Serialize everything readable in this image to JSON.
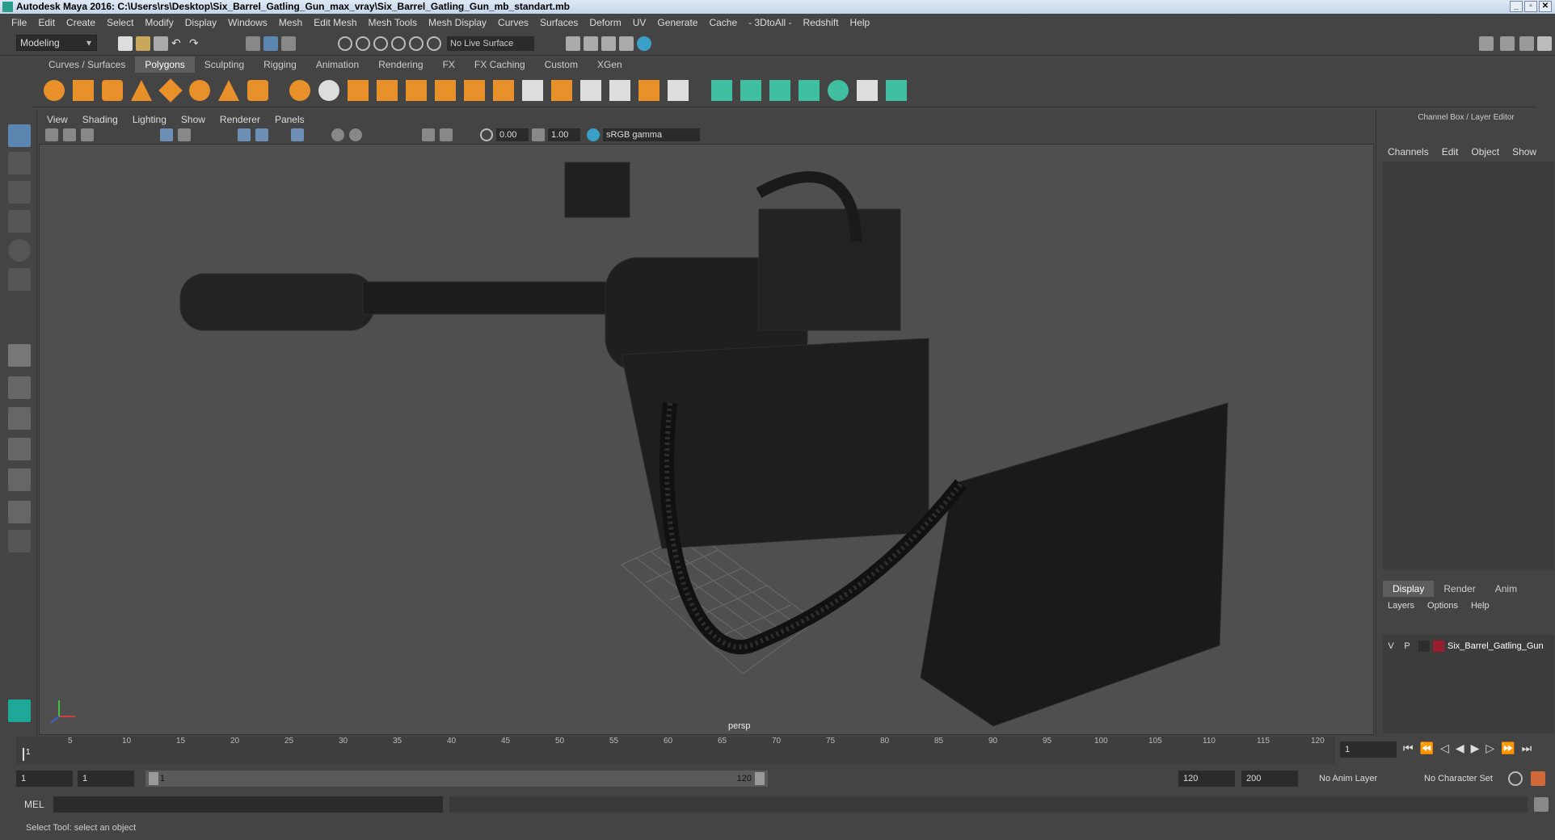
{
  "window": {
    "title": "Autodesk Maya 2016: C:\\Users\\rs\\Desktop\\Six_Barrel_Gatling_Gun_max_vray\\Six_Barrel_Gatling_Gun_mb_standart.mb"
  },
  "menubar": [
    "File",
    "Edit",
    "Create",
    "Select",
    "Modify",
    "Display",
    "Windows",
    "Mesh",
    "Edit Mesh",
    "Mesh Tools",
    "Mesh Display",
    "Curves",
    "Surfaces",
    "Deform",
    "UV",
    "Generate",
    "Cache",
    "- 3DtoAll -",
    "Redshift",
    "Help"
  ],
  "statusline": {
    "mode": "Modeling",
    "live_surface": "No Live Surface"
  },
  "shelf": {
    "tabs": [
      "Curves / Surfaces",
      "Polygons",
      "Sculpting",
      "Rigging",
      "Animation",
      "Rendering",
      "FX",
      "FX Caching",
      "Custom",
      "XGen"
    ],
    "active_tab": "Polygons"
  },
  "viewport": {
    "menu": [
      "View",
      "Shading",
      "Lighting",
      "Show",
      "Renderer",
      "Panels"
    ],
    "exposure": "0.00",
    "gamma": "1.00",
    "color_space": "sRGB gamma",
    "camera_label": "persp"
  },
  "channelbox": {
    "title": "Channel Box / Layer Editor",
    "menu": [
      "Channels",
      "Edit",
      "Object",
      "Show"
    ],
    "tabs": [
      "Display",
      "Render",
      "Anim"
    ],
    "active_tab": "Display",
    "layer_menu": [
      "Layers",
      "Options",
      "Help"
    ],
    "layer": {
      "v": "V",
      "p": "P",
      "name": "Six_Barrel_Gatling_Gun",
      "color": "#9b1c2f"
    }
  },
  "timeline": {
    "ticks": [
      "5",
      "10",
      "15",
      "20",
      "25",
      "30",
      "35",
      "40",
      "45",
      "50",
      "55",
      "60",
      "65",
      "70",
      "75",
      "80",
      "85",
      "90",
      "95",
      "100",
      "105",
      "110",
      "115",
      "120"
    ],
    "start_tick": "1",
    "current_frame": "1"
  },
  "range": {
    "start": "1",
    "playback_start": "1",
    "slider_start": "1",
    "slider_end": "120",
    "playback_end": "120",
    "end": "200",
    "anim_layer": "No Anim Layer",
    "character_set": "No Character Set"
  },
  "cmdline": {
    "label": "MEL"
  },
  "helpline": {
    "text": "Select Tool: select an object"
  }
}
